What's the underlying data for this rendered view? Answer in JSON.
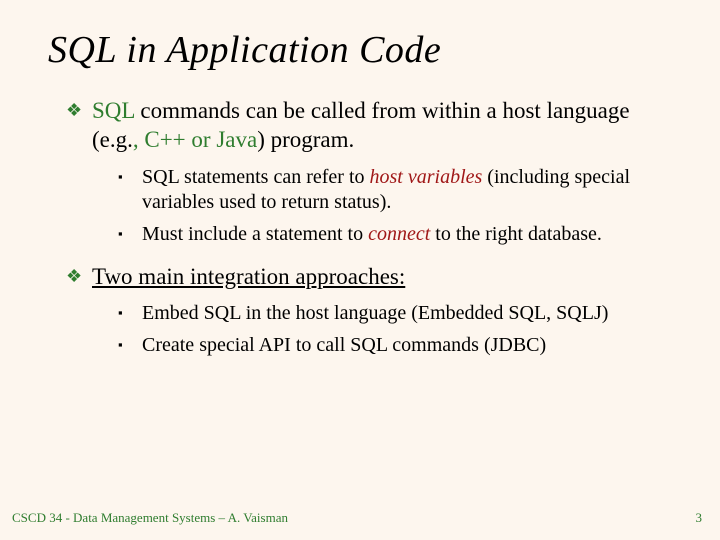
{
  "title": "SQL in Application Code",
  "bullet_glyph_l1": "❖",
  "bullet_glyph_l2": "▪",
  "b1_a_sql": "SQL",
  "b1_a_rest1": " commands can be called from within a host language (e.g.",
  "b1_a_inline": ", C++ or Java",
  "b1_a_rest2": ") program.",
  "b2_a_pre": "SQL statements can refer to ",
  "b2_a_em": "host variables",
  "b2_a_post": " (including special variables used to return status).",
  "b2_b_pre": "Must include a statement to ",
  "b2_b_em": "connect",
  "b2_b_post": " to the right database.",
  "b1_b": "Two main integration approaches:",
  "b2_c": "Embed SQL in the host language (Embedded SQL, SQLJ)",
  "b2_d": "Create special API to call SQL commands (JDBC)",
  "footer": "CSCD 34 - Data Management Systems – A. Vaisman",
  "page": "3"
}
